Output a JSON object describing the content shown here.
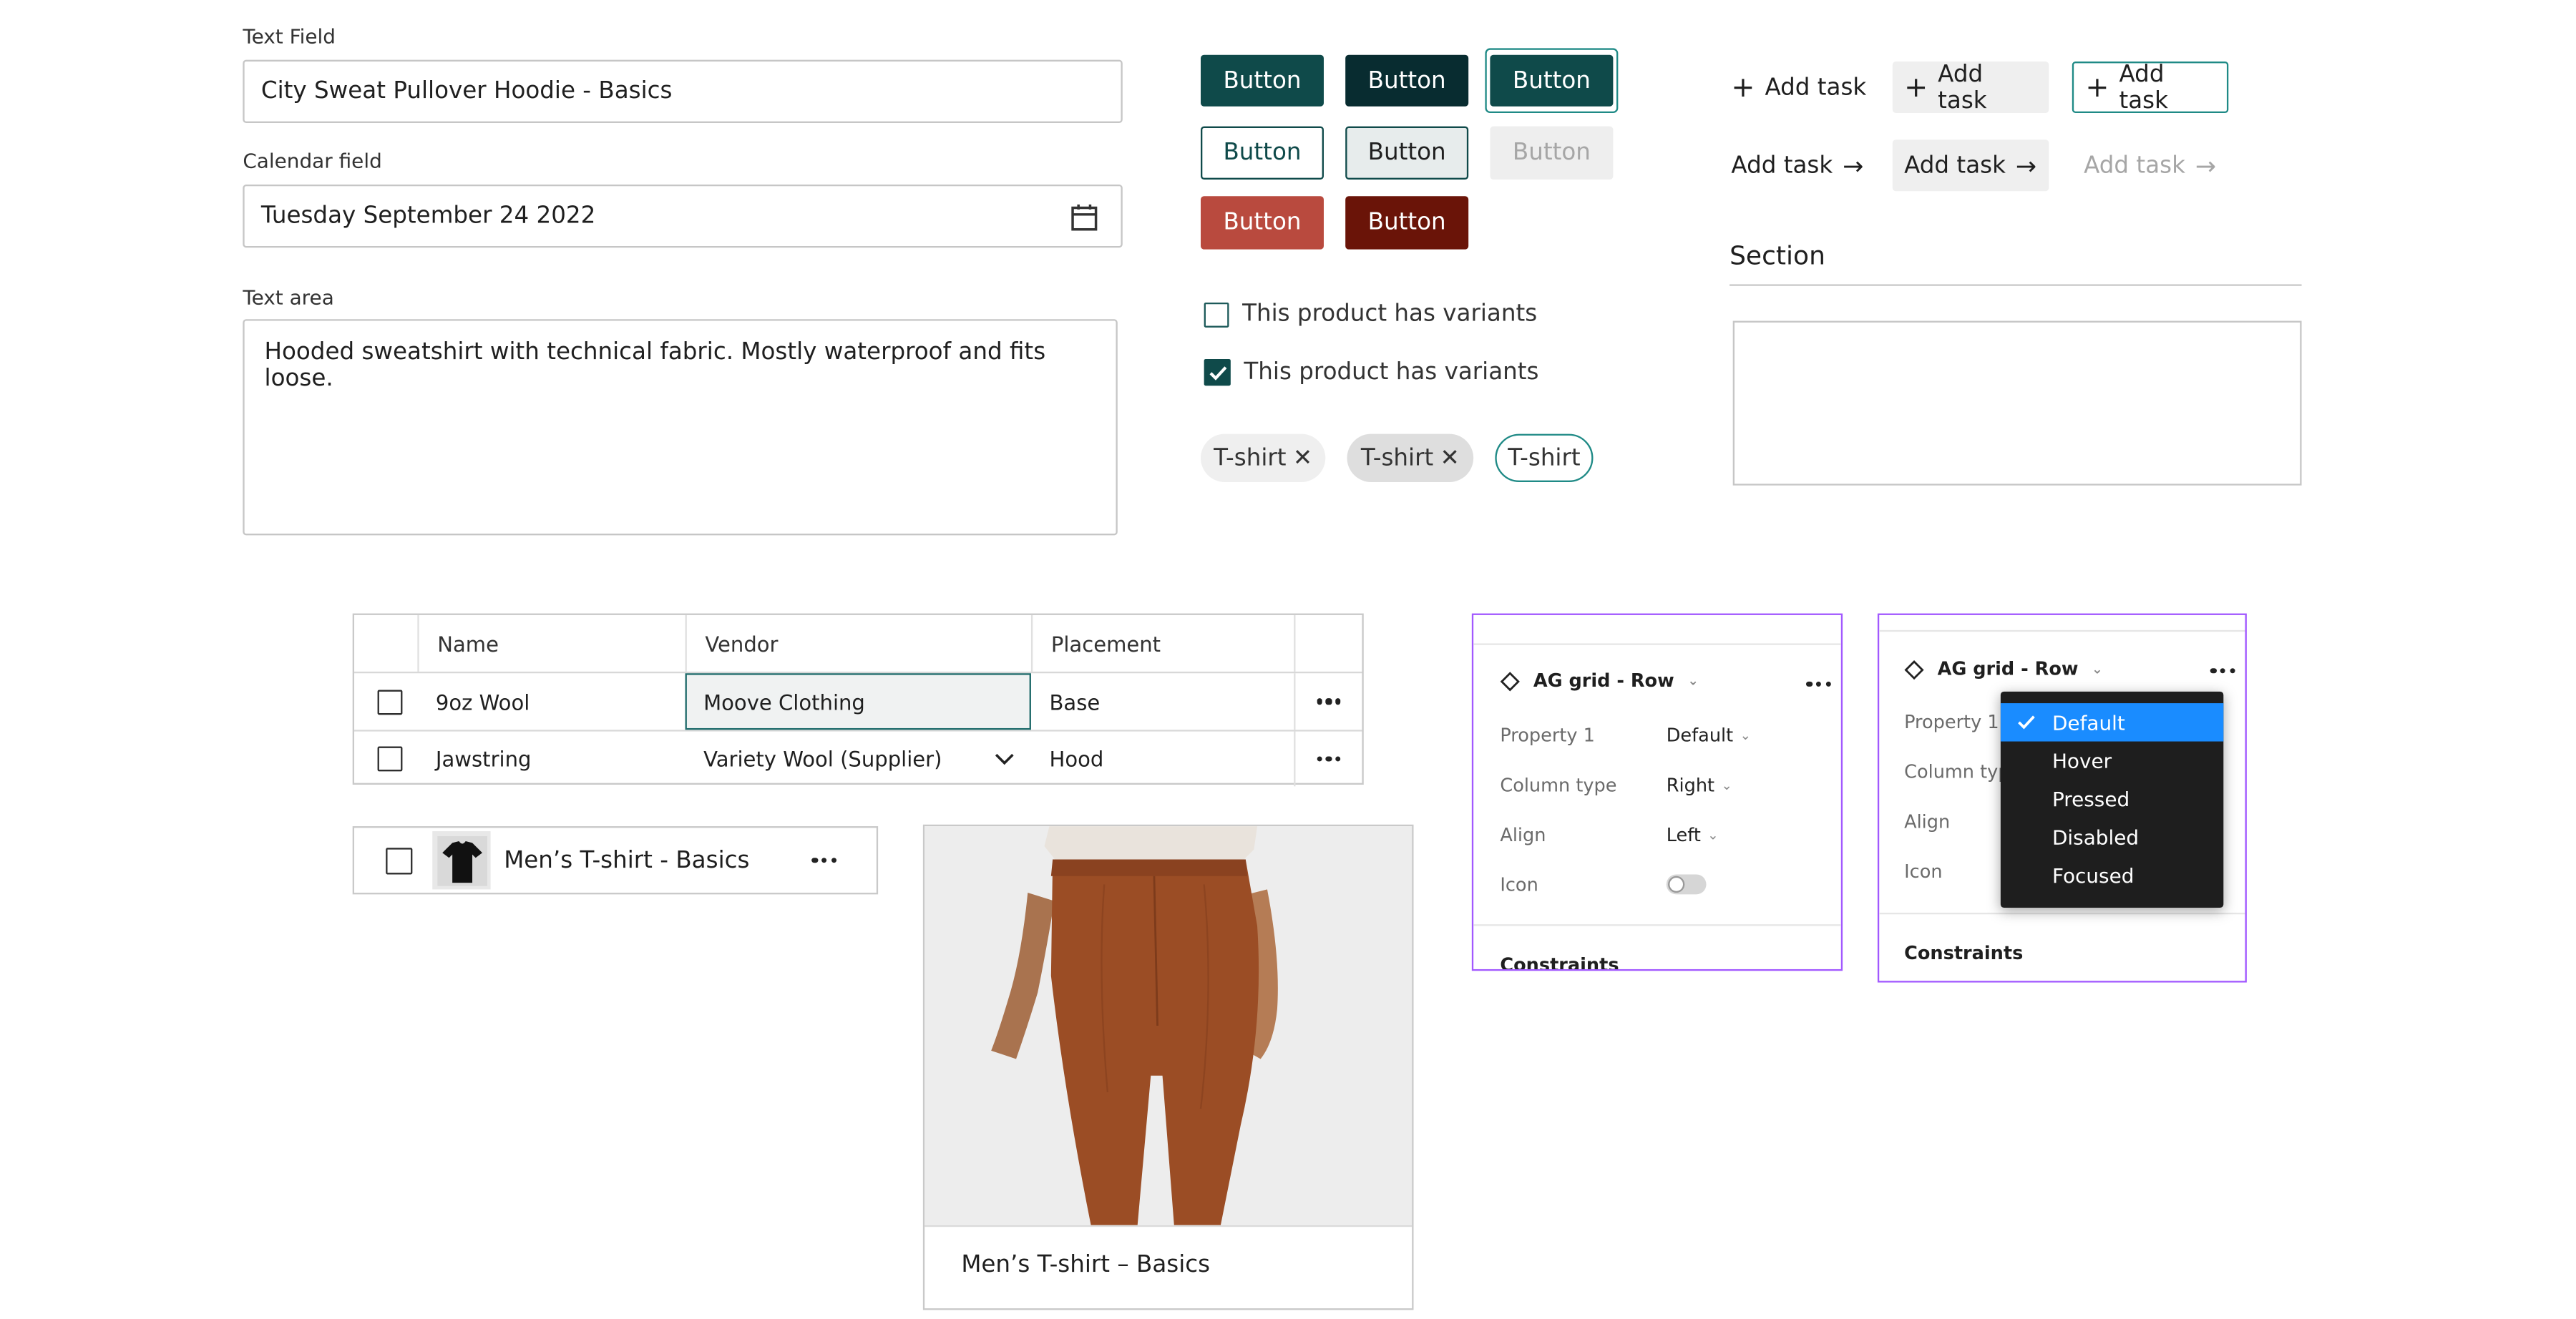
{
  "text_field": {
    "label": "Text Field",
    "value": "City Sweat Pullover Hoodie - Basics"
  },
  "calendar_field": {
    "label": "Calendar field",
    "value": "Tuesday September 24 2022",
    "icon": "calendar-icon"
  },
  "text_area": {
    "label": "Text area",
    "value": "Hooded sweatshirt with technical fabric. Mostly waterproof and fits loose."
  },
  "buttons": {
    "label": "Button"
  },
  "checkboxes": [
    {
      "label": "This product has variants",
      "checked": false
    },
    {
      "label": "This product has variants",
      "checked": true
    }
  ],
  "chips": [
    {
      "label": "T-shirt"
    },
    {
      "label": "T-shirt"
    },
    {
      "label": "T-shirt"
    }
  ],
  "tasks": {
    "label": "Add task"
  },
  "section": {
    "title": "Section"
  },
  "grid": {
    "headers": [
      "Name",
      "Vendor",
      "Placement"
    ],
    "rows": [
      {
        "name": "9oz Wool",
        "vendor": "Moove Clothing",
        "placement": "Base"
      },
      {
        "name": "Jawstring",
        "vendor": "Variety Wool (Supplier)",
        "placement": "Hood"
      }
    ]
  },
  "list_item": {
    "title": "Men’s T-shirt - Basics"
  },
  "product_card": {
    "title": "Men’s T-shirt – Basics"
  },
  "panel_left": {
    "title": "AG grid - Row",
    "props": [
      {
        "key": "Property 1",
        "value": "Default"
      },
      {
        "key": "Column type",
        "value": "Right"
      },
      {
        "key": "Align",
        "value": "Left"
      },
      {
        "key": "Icon",
        "value": ""
      }
    ],
    "toggle_on": false,
    "footer": "Constraints"
  },
  "panel_right": {
    "title": "AG grid - Row",
    "props": [
      {
        "key": "Property 1"
      },
      {
        "key": "Column typ"
      },
      {
        "key": "Align"
      },
      {
        "key": "Icon"
      }
    ],
    "menu": [
      "Default",
      "Hover",
      "Pressed",
      "Disabled",
      "Focused"
    ],
    "menu_selected": "Default",
    "footer": "Constraints"
  },
  "colors": {
    "teal_dark": "#0f4a4a",
    "teal_darkest": "#082c30",
    "danger": "#b94a3e",
    "danger_dark": "#6a1408",
    "accent_blue": "#1a8cff",
    "panel_border": "#a259ff",
    "pants": "#9b4d25"
  }
}
